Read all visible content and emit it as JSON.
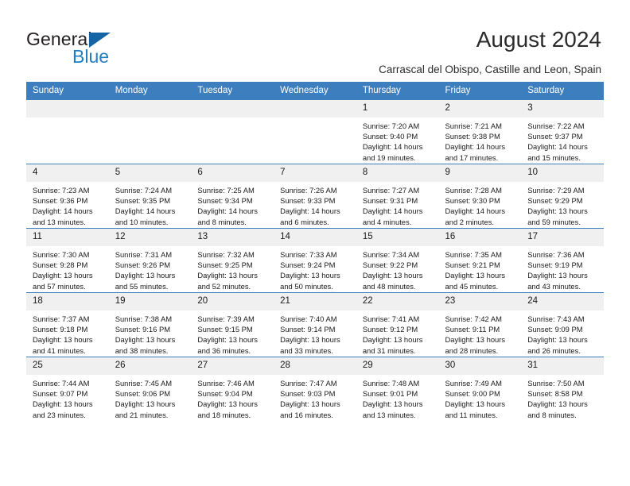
{
  "brand": {
    "name_part1": "General",
    "name_part2": "Blue",
    "triangle_color": "#1565a6",
    "blue_color": "#1f7fc4"
  },
  "header": {
    "title": "August 2024",
    "subtitle": "Carrascal del Obispo, Castille and Leon, Spain"
  },
  "theme": {
    "header_blue": "#3d7ebf",
    "daynum_bg": "#f0f0f0",
    "cell_bg": "#ffffff"
  },
  "weekdays": [
    "Sunday",
    "Monday",
    "Tuesday",
    "Wednesday",
    "Thursday",
    "Friday",
    "Saturday"
  ],
  "weeks": [
    [
      {
        "day": "",
        "empty": true
      },
      {
        "day": "",
        "empty": true
      },
      {
        "day": "",
        "empty": true
      },
      {
        "day": "",
        "empty": true
      },
      {
        "day": "1",
        "sunrise": "Sunrise: 7:20 AM",
        "sunset": "Sunset: 9:40 PM",
        "daylight_line1": "Daylight: 14 hours",
        "daylight_line2": "and 19 minutes."
      },
      {
        "day": "2",
        "sunrise": "Sunrise: 7:21 AM",
        "sunset": "Sunset: 9:38 PM",
        "daylight_line1": "Daylight: 14 hours",
        "daylight_line2": "and 17 minutes."
      },
      {
        "day": "3",
        "sunrise": "Sunrise: 7:22 AM",
        "sunset": "Sunset: 9:37 PM",
        "daylight_line1": "Daylight: 14 hours",
        "daylight_line2": "and 15 minutes."
      }
    ],
    [
      {
        "day": "4",
        "sunrise": "Sunrise: 7:23 AM",
        "sunset": "Sunset: 9:36 PM",
        "daylight_line1": "Daylight: 14 hours",
        "daylight_line2": "and 13 minutes."
      },
      {
        "day": "5",
        "sunrise": "Sunrise: 7:24 AM",
        "sunset": "Sunset: 9:35 PM",
        "daylight_line1": "Daylight: 14 hours",
        "daylight_line2": "and 10 minutes."
      },
      {
        "day": "6",
        "sunrise": "Sunrise: 7:25 AM",
        "sunset": "Sunset: 9:34 PM",
        "daylight_line1": "Daylight: 14 hours",
        "daylight_line2": "and 8 minutes."
      },
      {
        "day": "7",
        "sunrise": "Sunrise: 7:26 AM",
        "sunset": "Sunset: 9:33 PM",
        "daylight_line1": "Daylight: 14 hours",
        "daylight_line2": "and 6 minutes."
      },
      {
        "day": "8",
        "sunrise": "Sunrise: 7:27 AM",
        "sunset": "Sunset: 9:31 PM",
        "daylight_line1": "Daylight: 14 hours",
        "daylight_line2": "and 4 minutes."
      },
      {
        "day": "9",
        "sunrise": "Sunrise: 7:28 AM",
        "sunset": "Sunset: 9:30 PM",
        "daylight_line1": "Daylight: 14 hours",
        "daylight_line2": "and 2 minutes."
      },
      {
        "day": "10",
        "sunrise": "Sunrise: 7:29 AM",
        "sunset": "Sunset: 9:29 PM",
        "daylight_line1": "Daylight: 13 hours",
        "daylight_line2": "and 59 minutes."
      }
    ],
    [
      {
        "day": "11",
        "sunrise": "Sunrise: 7:30 AM",
        "sunset": "Sunset: 9:28 PM",
        "daylight_line1": "Daylight: 13 hours",
        "daylight_line2": "and 57 minutes."
      },
      {
        "day": "12",
        "sunrise": "Sunrise: 7:31 AM",
        "sunset": "Sunset: 9:26 PM",
        "daylight_line1": "Daylight: 13 hours",
        "daylight_line2": "and 55 minutes."
      },
      {
        "day": "13",
        "sunrise": "Sunrise: 7:32 AM",
        "sunset": "Sunset: 9:25 PM",
        "daylight_line1": "Daylight: 13 hours",
        "daylight_line2": "and 52 minutes."
      },
      {
        "day": "14",
        "sunrise": "Sunrise: 7:33 AM",
        "sunset": "Sunset: 9:24 PM",
        "daylight_line1": "Daylight: 13 hours",
        "daylight_line2": "and 50 minutes."
      },
      {
        "day": "15",
        "sunrise": "Sunrise: 7:34 AM",
        "sunset": "Sunset: 9:22 PM",
        "daylight_line1": "Daylight: 13 hours",
        "daylight_line2": "and 48 minutes."
      },
      {
        "day": "16",
        "sunrise": "Sunrise: 7:35 AM",
        "sunset": "Sunset: 9:21 PM",
        "daylight_line1": "Daylight: 13 hours",
        "daylight_line2": "and 45 minutes."
      },
      {
        "day": "17",
        "sunrise": "Sunrise: 7:36 AM",
        "sunset": "Sunset: 9:19 PM",
        "daylight_line1": "Daylight: 13 hours",
        "daylight_line2": "and 43 minutes."
      }
    ],
    [
      {
        "day": "18",
        "sunrise": "Sunrise: 7:37 AM",
        "sunset": "Sunset: 9:18 PM",
        "daylight_line1": "Daylight: 13 hours",
        "daylight_line2": "and 41 minutes."
      },
      {
        "day": "19",
        "sunrise": "Sunrise: 7:38 AM",
        "sunset": "Sunset: 9:16 PM",
        "daylight_line1": "Daylight: 13 hours",
        "daylight_line2": "and 38 minutes."
      },
      {
        "day": "20",
        "sunrise": "Sunrise: 7:39 AM",
        "sunset": "Sunset: 9:15 PM",
        "daylight_line1": "Daylight: 13 hours",
        "daylight_line2": "and 36 minutes."
      },
      {
        "day": "21",
        "sunrise": "Sunrise: 7:40 AM",
        "sunset": "Sunset: 9:14 PM",
        "daylight_line1": "Daylight: 13 hours",
        "daylight_line2": "and 33 minutes."
      },
      {
        "day": "22",
        "sunrise": "Sunrise: 7:41 AM",
        "sunset": "Sunset: 9:12 PM",
        "daylight_line1": "Daylight: 13 hours",
        "daylight_line2": "and 31 minutes."
      },
      {
        "day": "23",
        "sunrise": "Sunrise: 7:42 AM",
        "sunset": "Sunset: 9:11 PM",
        "daylight_line1": "Daylight: 13 hours",
        "daylight_line2": "and 28 minutes."
      },
      {
        "day": "24",
        "sunrise": "Sunrise: 7:43 AM",
        "sunset": "Sunset: 9:09 PM",
        "daylight_line1": "Daylight: 13 hours",
        "daylight_line2": "and 26 minutes."
      }
    ],
    [
      {
        "day": "25",
        "sunrise": "Sunrise: 7:44 AM",
        "sunset": "Sunset: 9:07 PM",
        "daylight_line1": "Daylight: 13 hours",
        "daylight_line2": "and 23 minutes."
      },
      {
        "day": "26",
        "sunrise": "Sunrise: 7:45 AM",
        "sunset": "Sunset: 9:06 PM",
        "daylight_line1": "Daylight: 13 hours",
        "daylight_line2": "and 21 minutes."
      },
      {
        "day": "27",
        "sunrise": "Sunrise: 7:46 AM",
        "sunset": "Sunset: 9:04 PM",
        "daylight_line1": "Daylight: 13 hours",
        "daylight_line2": "and 18 minutes."
      },
      {
        "day": "28",
        "sunrise": "Sunrise: 7:47 AM",
        "sunset": "Sunset: 9:03 PM",
        "daylight_line1": "Daylight: 13 hours",
        "daylight_line2": "and 16 minutes."
      },
      {
        "day": "29",
        "sunrise": "Sunrise: 7:48 AM",
        "sunset": "Sunset: 9:01 PM",
        "daylight_line1": "Daylight: 13 hours",
        "daylight_line2": "and 13 minutes."
      },
      {
        "day": "30",
        "sunrise": "Sunrise: 7:49 AM",
        "sunset": "Sunset: 9:00 PM",
        "daylight_line1": "Daylight: 13 hours",
        "daylight_line2": "and 11 minutes."
      },
      {
        "day": "31",
        "sunrise": "Sunrise: 7:50 AM",
        "sunset": "Sunset: 8:58 PM",
        "daylight_line1": "Daylight: 13 hours",
        "daylight_line2": "and 8 minutes."
      }
    ]
  ]
}
